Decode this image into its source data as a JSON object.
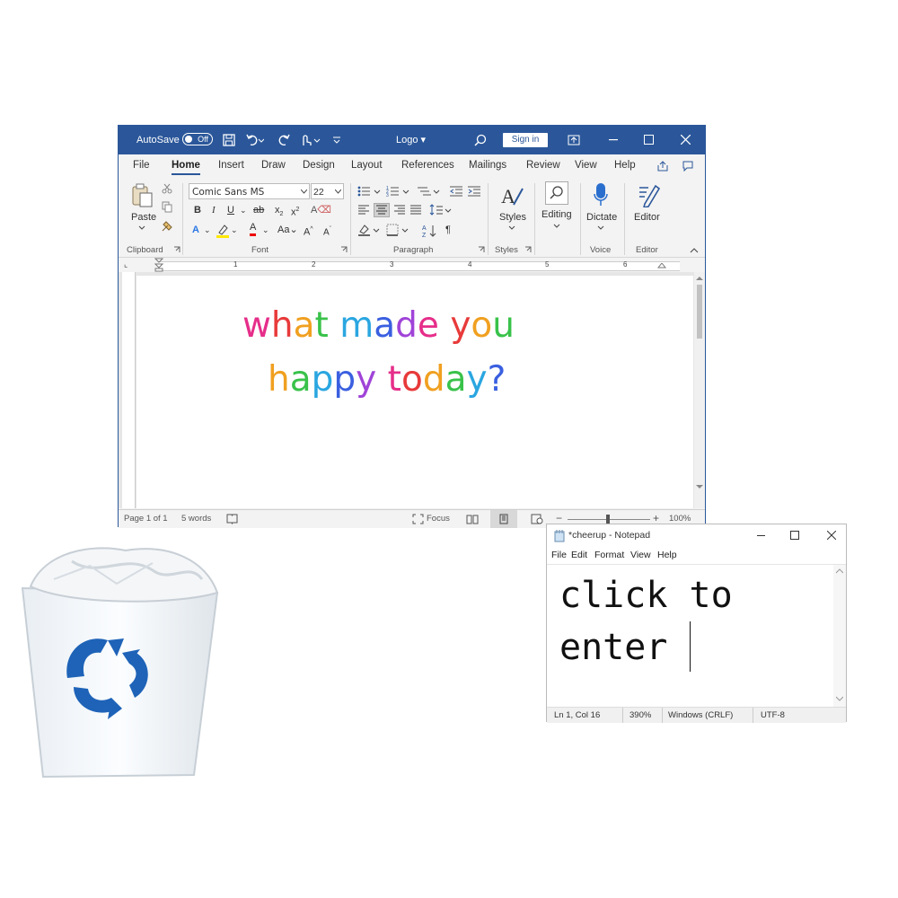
{
  "word": {
    "autosave_label": "AutoSave",
    "autosave_state": "Off",
    "doc_title": "Logo ▾",
    "signin_label": "Sign in",
    "tabs": [
      "File",
      "Home",
      "Insert",
      "Draw",
      "Design",
      "Layout",
      "References",
      "Mailings",
      "Review",
      "View",
      "Help"
    ],
    "font_name": "Comic Sans MS",
    "font_size": "22",
    "groups": {
      "clipboard": "Clipboard",
      "font": "Font",
      "paragraph": "Paragraph",
      "styles": "Styles",
      "voice": "Voice",
      "editor": "Editor"
    },
    "buttons": {
      "paste": "Paste",
      "styles": "Styles",
      "editing": "Editing",
      "dictate": "Dictate",
      "editor": "Editor"
    },
    "ruler_numbers": [
      "1",
      "2",
      "3",
      "4",
      "5",
      "6"
    ],
    "doc_lines": [
      [
        [
          "what",
          "#ee2c88"
        ],
        [
          " made",
          "#3377ee"
        ],
        [
          " you",
          "#2b5fd9"
        ]
      ],
      [
        [
          "happy",
          "#c43ddb"
        ],
        [
          " today?",
          "#f0a020"
        ]
      ]
    ],
    "status": {
      "page": "Page 1 of 1",
      "words": "5 words",
      "focus": "Focus",
      "zoom": "100%"
    },
    "colors": {
      "titlebar": "#2b579a",
      "accent": "#2b579a"
    }
  },
  "notepad": {
    "title": "*cheerup - Notepad",
    "menu": [
      "File",
      "Edit",
      "Format",
      "View",
      "Help"
    ],
    "content_line1": "click to",
    "content_line2": "enter ",
    "status": {
      "position": "Ln 1, Col 16",
      "zoom": "390%",
      "line_ending": "Windows (CRLF)",
      "encoding": "UTF-8"
    }
  },
  "desktop": {
    "recycle_bin_icon": "recycle-bin-icon"
  }
}
